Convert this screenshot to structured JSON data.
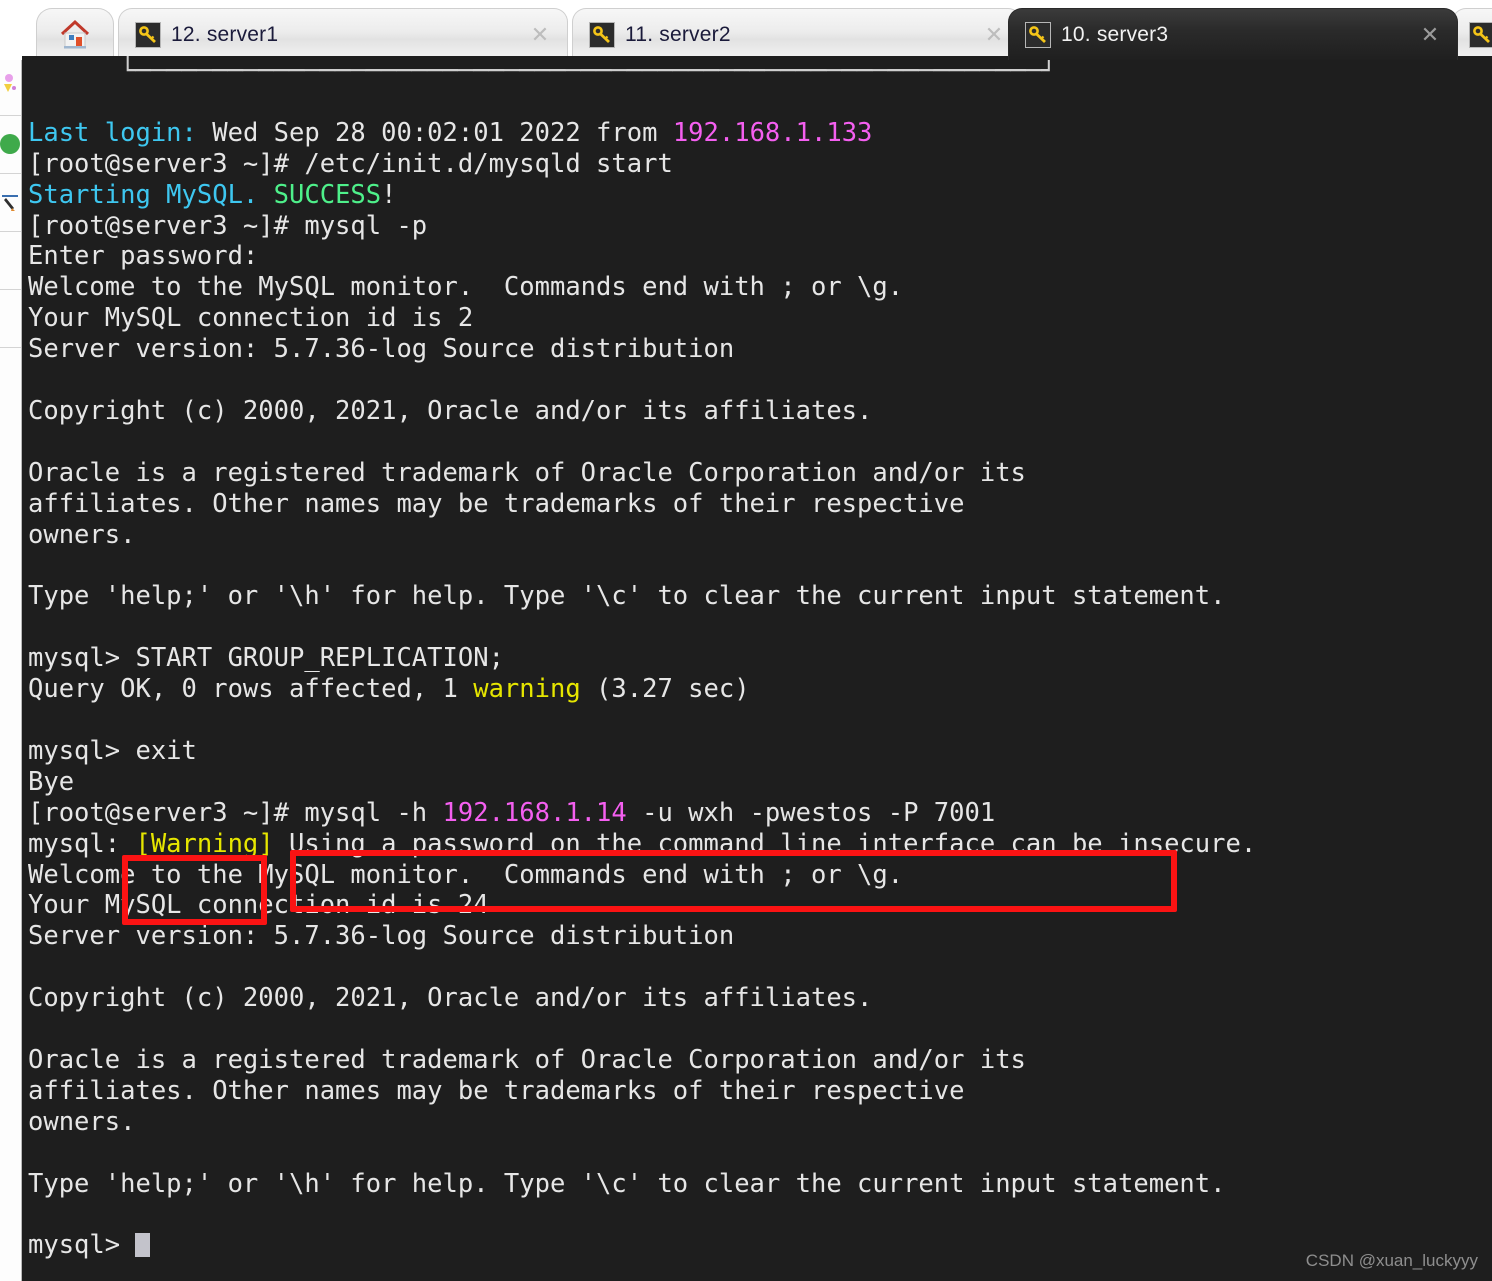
{
  "window": {
    "tabs": [
      {
        "label": "12. server1",
        "icon": "key-icon",
        "close": "✕",
        "active": false
      },
      {
        "label": "11. server2",
        "icon": "key-icon",
        "close": "✕",
        "active": false
      },
      {
        "label": "10. server3",
        "icon": "key-icon",
        "close": "✕",
        "active": true
      }
    ],
    "home_tab": {
      "name": "home-tab",
      "icon": "home-icon"
    },
    "colors": {
      "terminal_bg": "#1e1e1e",
      "terminal_fg": "#e6e6e6",
      "cyan": "#3ec7f0",
      "magenta": "#f45ff0",
      "green": "#4ef08a",
      "yellow": "#e6e600",
      "annotation_red": "#fb1313",
      "active_tab_bg": "#2b2b2b"
    }
  },
  "terminal": {
    "lines": [
      {
        "segments": [
          {
            "t": "      └───────────────────────────────────────────────────────────┘",
            "c": "c-box"
          }
        ]
      },
      {
        "segments": [
          {
            "t": "",
            "c": "c-white"
          }
        ]
      },
      {
        "segments": [
          {
            "t": "Last login:",
            "c": "c-cyan"
          },
          {
            "t": " Wed Sep 28 00:02:01 2022 from ",
            "c": "c-white"
          },
          {
            "t": "192.168.1.133",
            "c": "c-magenta"
          }
        ]
      },
      {
        "segments": [
          {
            "t": "[root@server3 ~]# /etc/init.d/mysqld start",
            "c": "c-white"
          }
        ]
      },
      {
        "segments": [
          {
            "t": "Starting MySQL.",
            "c": "c-cyan"
          },
          {
            "t": " ",
            "c": "c-white"
          },
          {
            "t": "SUCCESS",
            "c": "c-green"
          },
          {
            "t": "!",
            "c": "c-white"
          }
        ]
      },
      {
        "segments": [
          {
            "t": "[root@server3 ~]# mysql -p",
            "c": "c-white"
          }
        ]
      },
      {
        "segments": [
          {
            "t": "Enter password:",
            "c": "c-white"
          }
        ]
      },
      {
        "segments": [
          {
            "t": "Welcome to the MySQL monitor.  Commands end with ; or \\g.",
            "c": "c-white"
          }
        ]
      },
      {
        "segments": [
          {
            "t": "Your MySQL connection id is 2",
            "c": "c-white"
          }
        ]
      },
      {
        "segments": [
          {
            "t": "Server version: 5.7.36-log Source distribution",
            "c": "c-white"
          }
        ]
      },
      {
        "segments": [
          {
            "t": "",
            "c": "c-white"
          }
        ]
      },
      {
        "segments": [
          {
            "t": "Copyright (c) 2000, 2021, Oracle and/or its affiliates.",
            "c": "c-white"
          }
        ]
      },
      {
        "segments": [
          {
            "t": "",
            "c": "c-white"
          }
        ]
      },
      {
        "segments": [
          {
            "t": "Oracle is a registered trademark of Oracle Corporation and/or its",
            "c": "c-white"
          }
        ]
      },
      {
        "segments": [
          {
            "t": "affiliates. Other names may be trademarks of their respective",
            "c": "c-white"
          }
        ]
      },
      {
        "segments": [
          {
            "t": "owners.",
            "c": "c-white"
          }
        ]
      },
      {
        "segments": [
          {
            "t": "",
            "c": "c-white"
          }
        ]
      },
      {
        "segments": [
          {
            "t": "Type 'help;' or '\\h' for help. Type '\\c' to clear the current input statement.",
            "c": "c-white"
          }
        ]
      },
      {
        "segments": [
          {
            "t": "",
            "c": "c-white"
          }
        ]
      },
      {
        "segments": [
          {
            "t": "mysql> START GROUP_REPLICATION;",
            "c": "c-white"
          }
        ]
      },
      {
        "segments": [
          {
            "t": "Query OK, 0 rows affected, 1 ",
            "c": "c-white"
          },
          {
            "t": "warning",
            "c": "c-yellow"
          },
          {
            "t": " (3.27 sec)",
            "c": "c-white"
          }
        ]
      },
      {
        "segments": [
          {
            "t": "",
            "c": "c-white"
          }
        ]
      },
      {
        "segments": [
          {
            "t": "mysql> exit",
            "c": "c-white"
          }
        ]
      },
      {
        "segments": [
          {
            "t": "Bye",
            "c": "c-white"
          }
        ]
      },
      {
        "segments": [
          {
            "t": "[root@server3 ~]# mysql -h ",
            "c": "c-white"
          },
          {
            "t": "192.168.1.14",
            "c": "c-magenta"
          },
          {
            "t": " -u wxh -pwestos -P 7001",
            "c": "c-white"
          }
        ]
      },
      {
        "segments": [
          {
            "t": "mysql: ",
            "c": "c-white"
          },
          {
            "t": "[Warning]",
            "c": "c-yellow"
          },
          {
            "t": " Using a password on the command line interface can be insecure.",
            "c": "c-white"
          }
        ]
      },
      {
        "segments": [
          {
            "t": "Welcome to the MySQL monitor.  Commands end with ; or \\g.",
            "c": "c-white"
          }
        ]
      },
      {
        "segments": [
          {
            "t": "Your MySQL connection id is 24",
            "c": "c-white"
          }
        ]
      },
      {
        "segments": [
          {
            "t": "Server version: 5.7.36-log Source distribution",
            "c": "c-white"
          }
        ]
      },
      {
        "segments": [
          {
            "t": "",
            "c": "c-white"
          }
        ]
      },
      {
        "segments": [
          {
            "t": "Copyright (c) 2000, 2021, Oracle and/or its affiliates.",
            "c": "c-white"
          }
        ]
      },
      {
        "segments": [
          {
            "t": "",
            "c": "c-white"
          }
        ]
      },
      {
        "segments": [
          {
            "t": "Oracle is a registered trademark of Oracle Corporation and/or its",
            "c": "c-white"
          }
        ]
      },
      {
        "segments": [
          {
            "t": "affiliates. Other names may be trademarks of their respective",
            "c": "c-white"
          }
        ]
      },
      {
        "segments": [
          {
            "t": "owners.",
            "c": "c-white"
          }
        ]
      },
      {
        "segments": [
          {
            "t": "",
            "c": "c-white"
          }
        ]
      },
      {
        "segments": [
          {
            "t": "Type 'help;' or '\\h' for help. Type '\\c' to clear the current input statement.",
            "c": "c-white"
          }
        ]
      },
      {
        "segments": [
          {
            "t": "",
            "c": "c-white"
          }
        ]
      },
      {
        "segments": [
          {
            "t": "mysql> ",
            "c": "c-white"
          },
          {
            "t": "",
            "c": "cursor"
          }
        ]
      }
    ]
  },
  "annotations": [
    {
      "name": "redbox-hostname",
      "target": "@server3"
    },
    {
      "name": "redbox-mysql-command",
      "target": "# mysql -h 192.168.1.14 -u wxh -pwestos -P 7001"
    }
  ],
  "watermark": {
    "text": "CSDN @xuan_luckyyy"
  }
}
